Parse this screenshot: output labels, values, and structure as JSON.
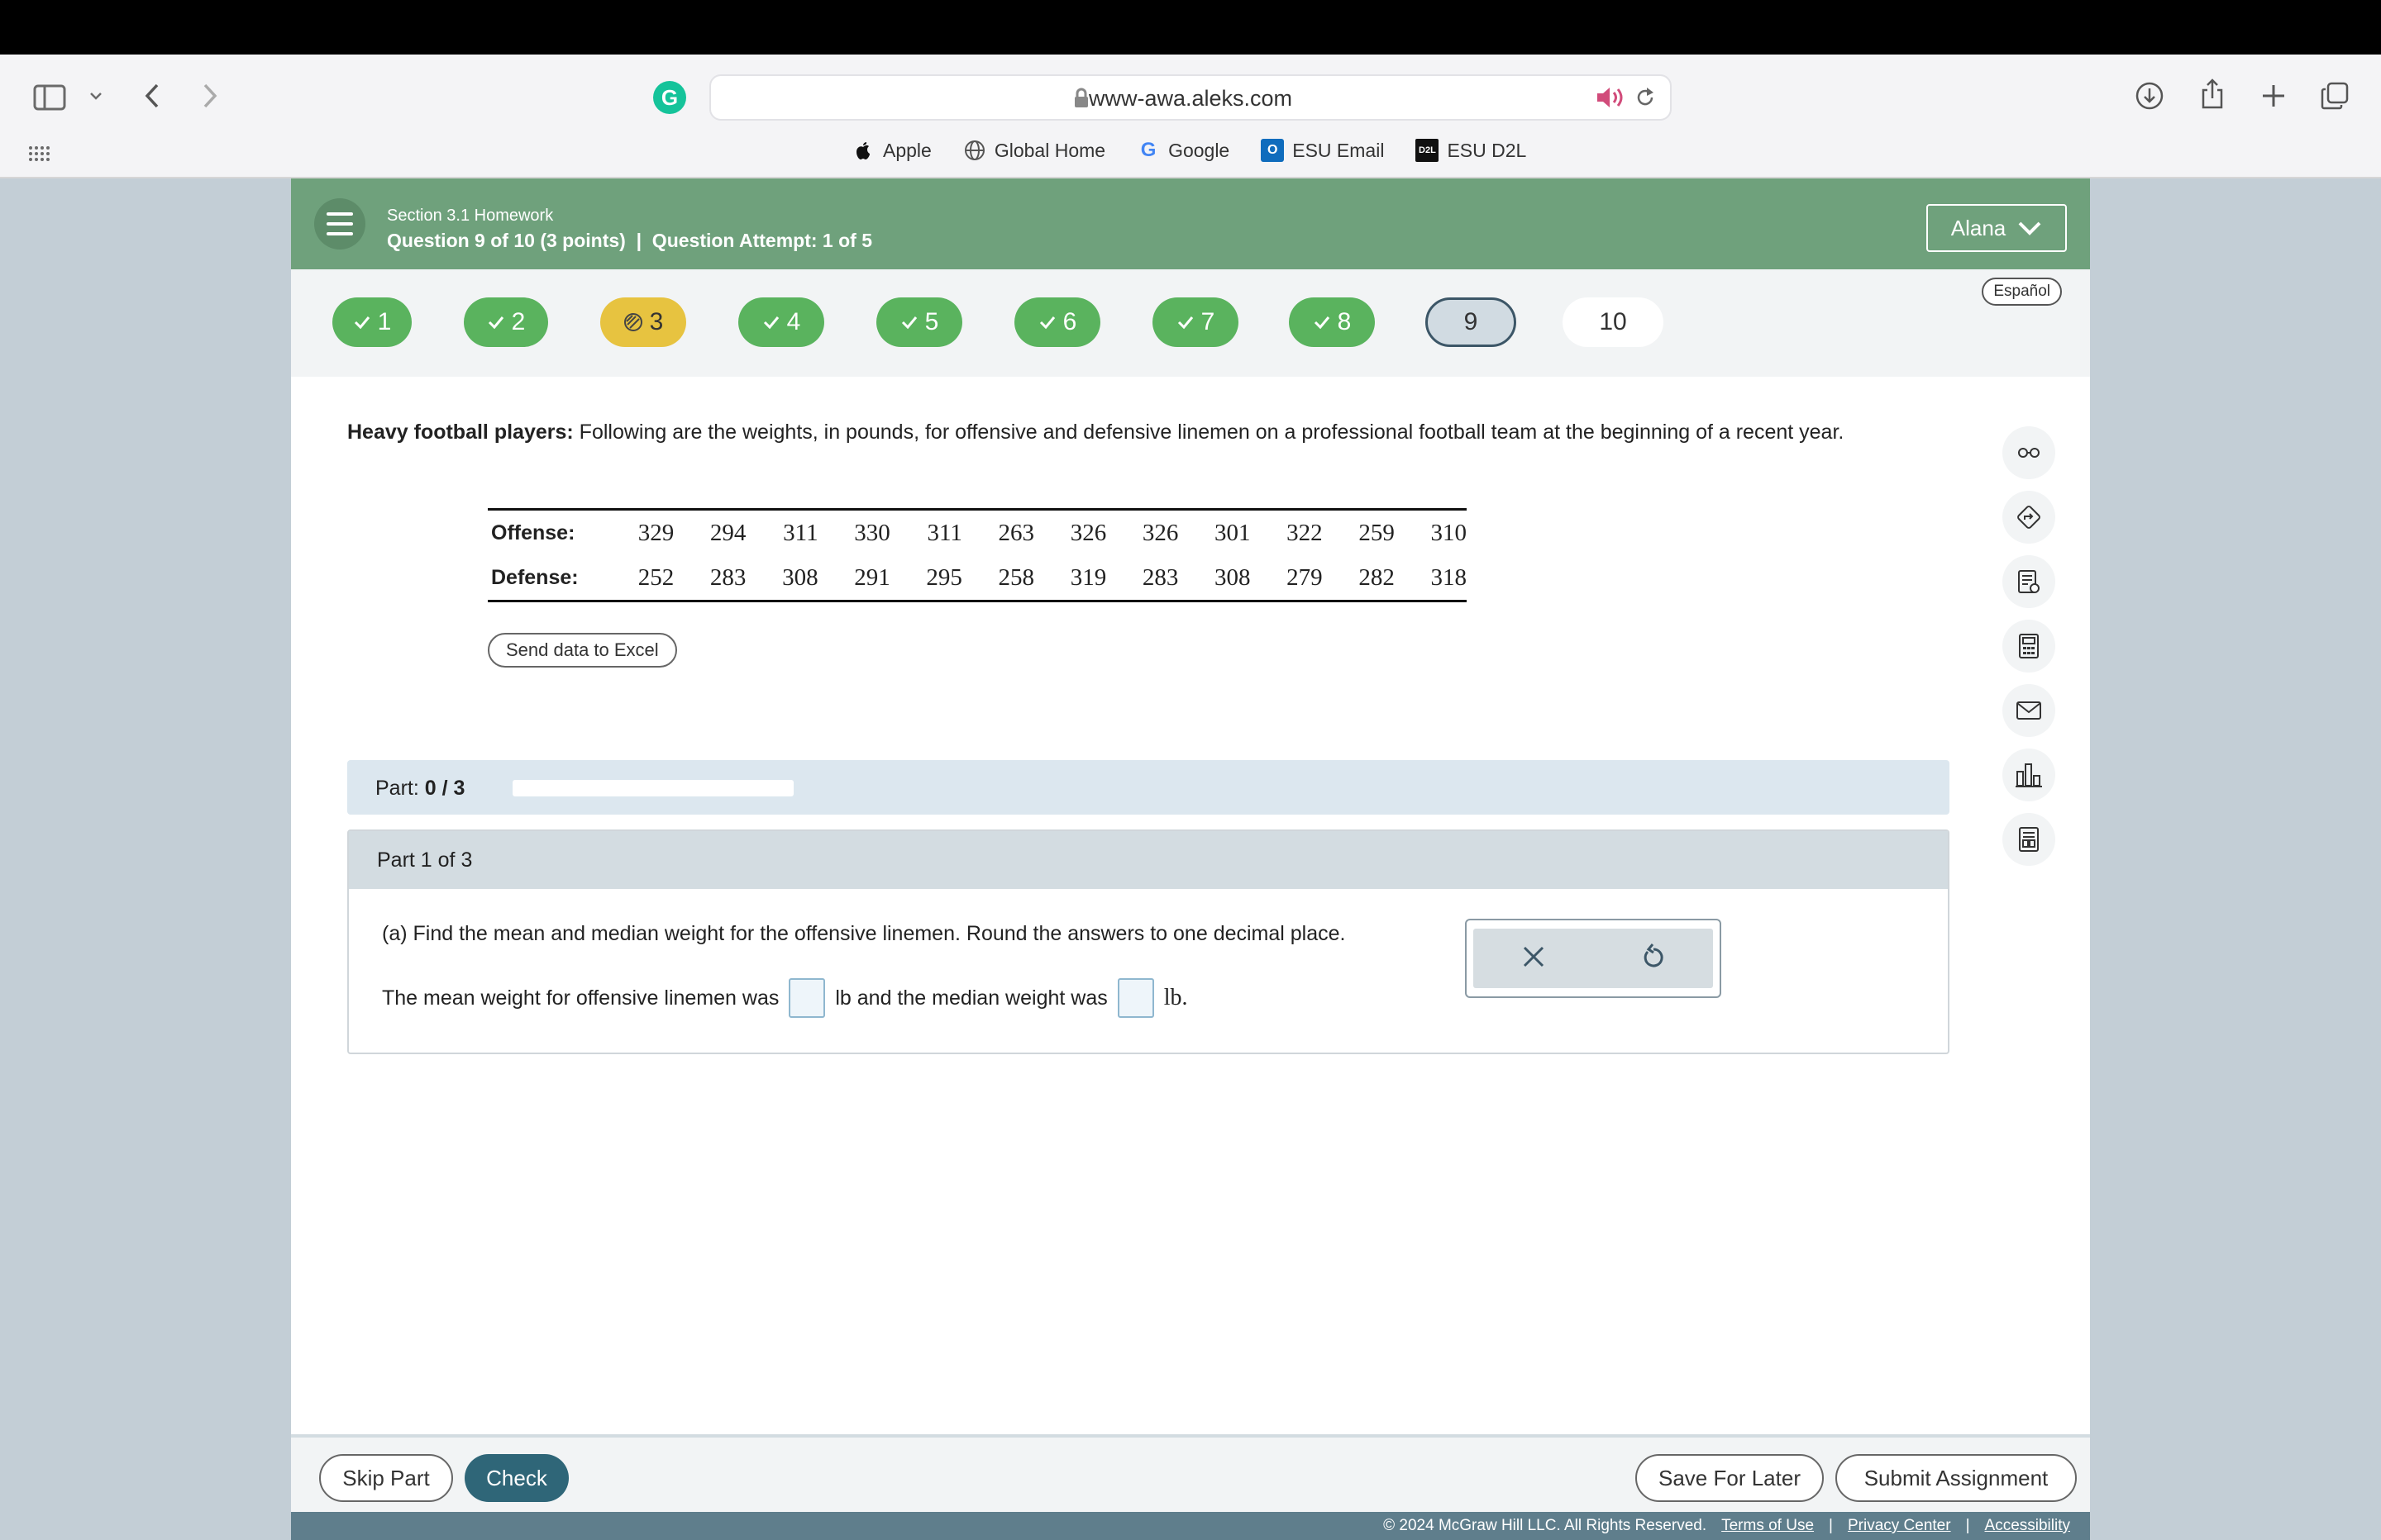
{
  "browser": {
    "url": "www-awa.aleks.com",
    "bookmarks": [
      {
        "label": "Apple",
        "icon": "apple-icon"
      },
      {
        "label": "Global Home",
        "icon": "globe-icon"
      },
      {
        "label": "Google",
        "icon": "google-icon"
      },
      {
        "label": "ESU Email",
        "icon": "outlook-icon"
      },
      {
        "label": "ESU D2L",
        "icon": "d2l-icon"
      }
    ]
  },
  "header": {
    "section": "Section 3.1 Homework",
    "question_info": "Question 9 of 10 (3 points)  |  Question Attempt: 1 of 5",
    "user": "Alana",
    "language": "Español"
  },
  "question_nav": [
    {
      "label": "1",
      "state": "done"
    },
    {
      "label": "2",
      "state": "done"
    },
    {
      "label": "3",
      "state": "partial"
    },
    {
      "label": "4",
      "state": "done"
    },
    {
      "label": "5",
      "state": "done"
    },
    {
      "label": "6",
      "state": "done"
    },
    {
      "label": "7",
      "state": "done"
    },
    {
      "label": "8",
      "state": "done"
    },
    {
      "label": "9",
      "state": "current"
    },
    {
      "label": "10",
      "state": "todo"
    }
  ],
  "problem": {
    "title": "Heavy football players:",
    "text": "Following are the weights, in pounds, for offensive and defensive linemen on a professional football team at the beginning of a recent year."
  },
  "table": {
    "rows": [
      {
        "label": "Offense:",
        "values": [
          "329",
          "294",
          "311",
          "330",
          "311",
          "263",
          "326",
          "326",
          "301",
          "322",
          "259",
          "310"
        ]
      },
      {
        "label": "Defense:",
        "values": [
          "252",
          "283",
          "308",
          "291",
          "295",
          "258",
          "319",
          "283",
          "308",
          "279",
          "282",
          "318"
        ]
      }
    ]
  },
  "excel_button": "Send data to Excel",
  "part_progress": {
    "label": "Part:",
    "value": "0 / 3",
    "fraction": 0
  },
  "part": {
    "heading": "Part 1 of 3",
    "question": "(a) Find the mean and median weight for the offensive linemen. Round the answers to one decimal place.",
    "answer_prefix": "The mean weight for offensive linemen was",
    "answer_mid": "lb and the median weight was",
    "answer_suffix": "lb."
  },
  "buttons": {
    "skip": "Skip Part",
    "check": "Check",
    "save": "Save For Later",
    "submit": "Submit Assignment"
  },
  "footer": {
    "copyright": "© 2024 McGraw Hill LLC. All Rights Reserved.",
    "terms": "Terms of Use",
    "privacy": "Privacy Center",
    "accessibility": "Accessibility"
  },
  "colors": {
    "header": "#6fa17c",
    "done": "#5ab35e",
    "partial": "#e7c340",
    "primary": "#2f6678"
  }
}
